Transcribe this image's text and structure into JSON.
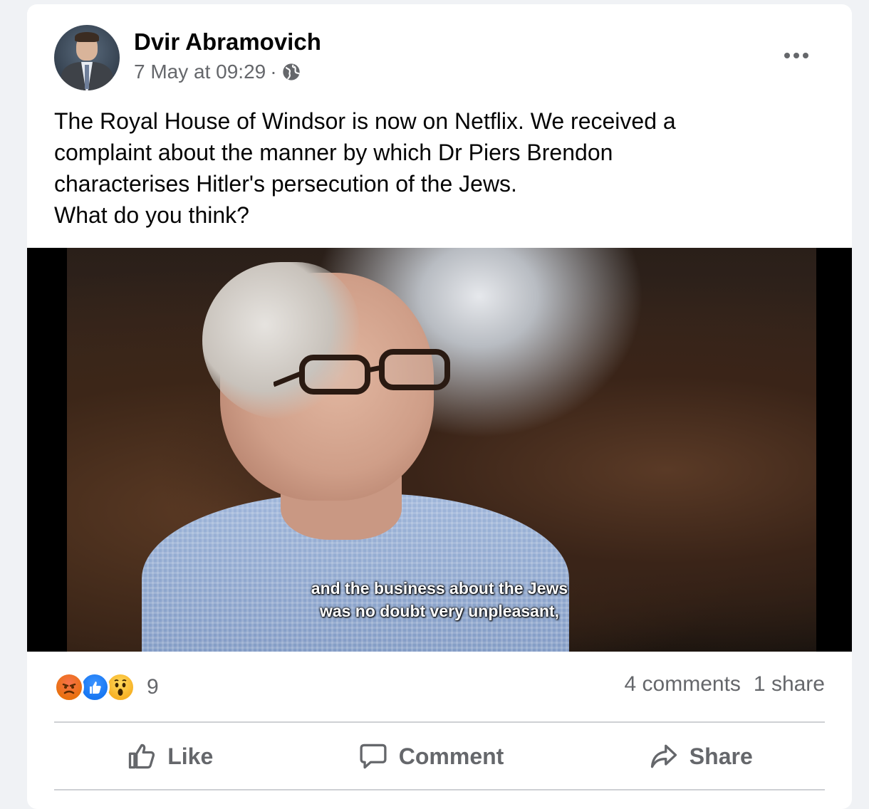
{
  "post": {
    "author": "Dvir Abramovich",
    "timestamp": "7 May at 09:29",
    "separator": "·",
    "visibility_icon": "globe-icon",
    "more_icon": "more-options-icon",
    "text_lines": [
      "The Royal House of Windsor is now on Netflix. We received a",
      "complaint about the manner by which Dr Piers Brendon",
      "characterises Hitler's persecution of the Jews.",
      "What do you think?"
    ]
  },
  "media": {
    "subtitle_lines": [
      "and the business about the Jews",
      "was no doubt very unpleasant,"
    ]
  },
  "engagement": {
    "reaction_icons": [
      "angry-icon",
      "like-icon",
      "wow-icon"
    ],
    "reaction_count": "9",
    "comments": "4 comments",
    "shares": "1 share"
  },
  "actions": {
    "like": "Like",
    "comment": "Comment",
    "share": "Share"
  },
  "colors": {
    "secondary_text": "#65676b",
    "like_blue": "#1877f2",
    "angry_orange": "#e9710f",
    "wow_yellow": "#f7b125",
    "divider": "#ced0d4"
  }
}
